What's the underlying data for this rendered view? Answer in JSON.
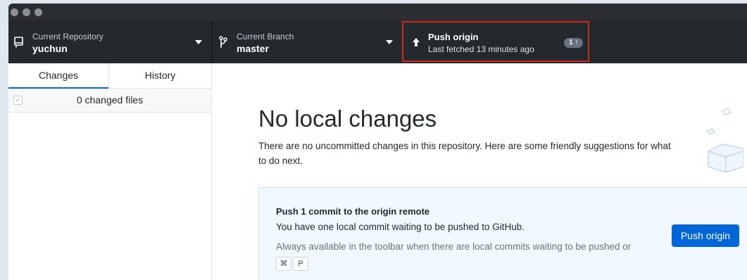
{
  "window": {
    "controls": [
      "close",
      "minimize",
      "zoom"
    ]
  },
  "toolbar": {
    "repository": {
      "label": "Current Repository",
      "value": "yuchun",
      "icon": "repo-icon"
    },
    "branch": {
      "label": "Current Branch",
      "value": "master",
      "icon": "branch-icon"
    },
    "push": {
      "label": "Push origin",
      "subtitle": "Last fetched 13 minutes ago",
      "badge": "1",
      "icon": "arrow-up-icon"
    }
  },
  "sidebar": {
    "tabs": [
      {
        "label": "Changes",
        "active": true
      },
      {
        "label": "History",
        "active": false
      }
    ],
    "changed_files": "0 changed files"
  },
  "main": {
    "heading": "No local changes",
    "description": "There are no uncommitted changes in this repository. Here are some friendly suggestions for what to do next.",
    "card": {
      "title": "Push 1 commit to the origin remote",
      "description": "You have one local commit waiting to be pushed to GitHub.",
      "hint": "Always available in the toolbar when there are local commits waiting to be pushed or",
      "shortcut": [
        "⌘",
        "P"
      ],
      "button": "Push origin"
    }
  },
  "colors": {
    "toolbar_bg": "#24292e",
    "accent_blue": "#0366d6",
    "highlight_red": "#d0271d"
  }
}
